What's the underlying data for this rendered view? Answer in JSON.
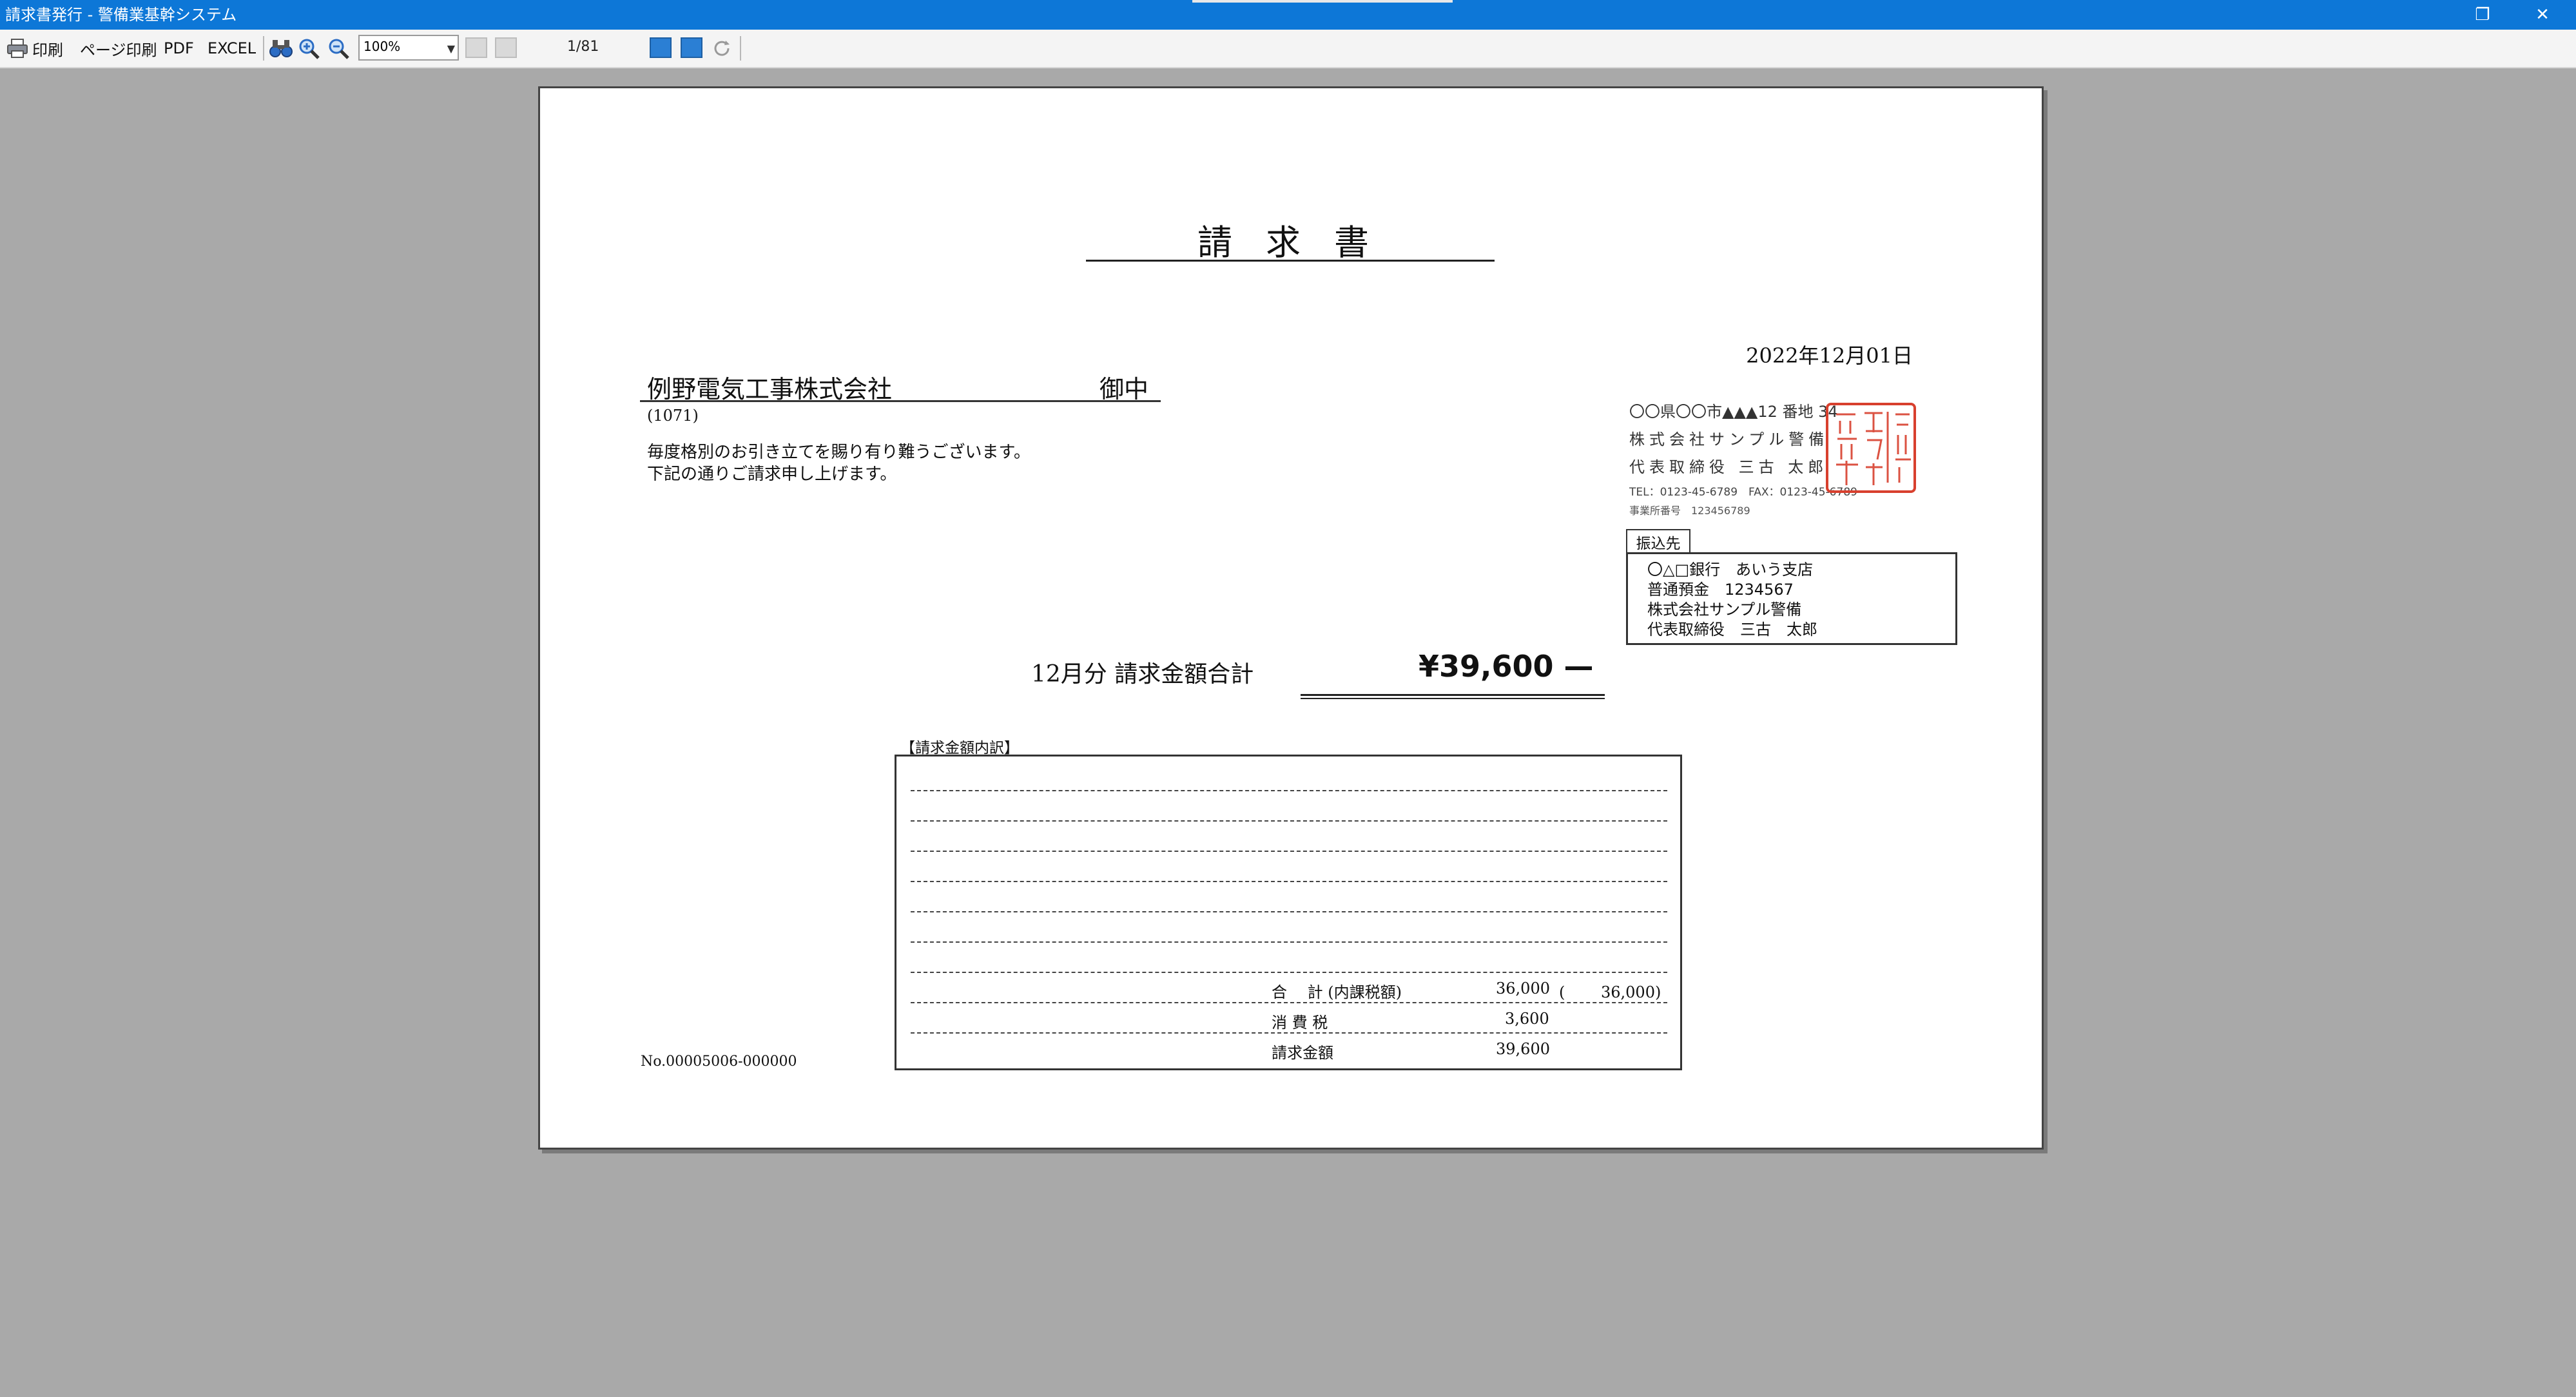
{
  "window": {
    "title": "請求書発行 - 警備業基幹システム",
    "restore_icon": "❐",
    "close_icon": "✕"
  },
  "toolbar": {
    "print_label": "印刷",
    "page_print_label": "ページ印刷",
    "pdf_label": "PDF",
    "excel_label": "EXCEL",
    "zoom_value": "100%",
    "page_indicator": "1/81",
    "icons": [
      "printer-icon",
      "binoculars-icon",
      "zoom-in-icon",
      "zoom-out-icon",
      "first-page-icon",
      "previous-page-icon",
      "next-page-icon",
      "last-page-icon",
      "refresh-icon"
    ]
  },
  "document": {
    "title": "請求書",
    "date": "2022年12月01日",
    "recipient": "例野電気工事株式会社",
    "honorific": "御中",
    "customer_code": "(1071)",
    "greeting_line1": "毎度格別のお引き立てを賜り有り難うございます。",
    "greeting_line2": "下記の通りご請求申し上げます。",
    "issuer": {
      "address": "〇〇県〇〇市▲▲▲12 番地 34",
      "company": "株式会社サンプル警備",
      "representative": "代表取締役 三古 太郎",
      "tel_fax": "TEL：0123-45-6789　FAX：0123-45-6789",
      "office_number": "事業所番号　123456789",
      "seal_text": "株式会社サンプル警備",
      "seal_color": "#d8402e"
    },
    "bank": {
      "tab_label": "振込先",
      "bank_name": "〇△□銀行　あいう支店",
      "account": "普通預金　1234567",
      "holder_company": "株式会社サンプル警備",
      "holder_person": "代表取締役　三古　太郎"
    },
    "total_label": "12月分 請求金額合計",
    "total_amount": "¥39,600 —",
    "breakdown": {
      "label": "【請求金額内訳】",
      "subtotal_label": "合　 計 (内課税額)",
      "subtotal_value": "36,000",
      "subtotal_tax_included": "(　　 36,000)",
      "tax_label": "消 費 税",
      "tax_value": "3,600",
      "billed_label": "請求金額",
      "billed_value": "39,600"
    },
    "doc_number": "No.00005006-000000"
  }
}
